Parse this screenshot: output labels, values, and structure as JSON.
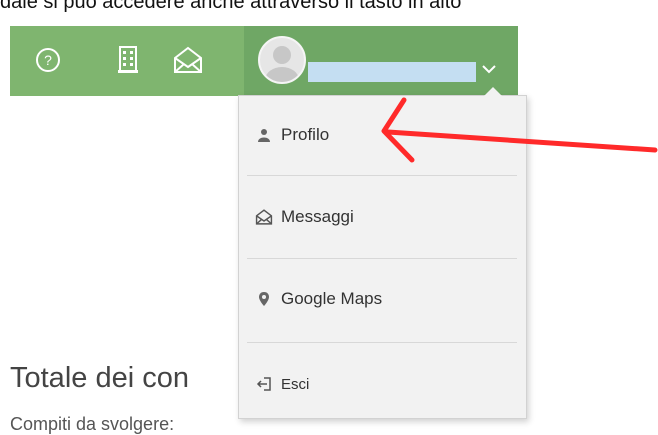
{
  "caption": {
    "text": "dale si può accedere anche attraverso il tasto in alto"
  },
  "navbar": {
    "bg_color": "#7fb56f",
    "icons": [
      {
        "name": "help-icon"
      },
      {
        "name": "building-icon"
      },
      {
        "name": "envelope-open-icon"
      }
    ],
    "user": {
      "avatar": "avatar-placeholder",
      "name_redacted": true
    }
  },
  "dropdown": {
    "items": [
      {
        "label": "Profilo",
        "icon": "user-icon"
      },
      {
        "label": "Messaggi",
        "icon": "envelope-open-icon"
      },
      {
        "label": "Google Maps",
        "icon": "map-marker-icon"
      },
      {
        "label": "Esci",
        "icon": "sign-out-icon"
      }
    ]
  },
  "page": {
    "heading": "Totale dei con",
    "subtext": "Compiti da svolgere:"
  },
  "annotation": {
    "arrow_color": "#ff2a2a"
  }
}
